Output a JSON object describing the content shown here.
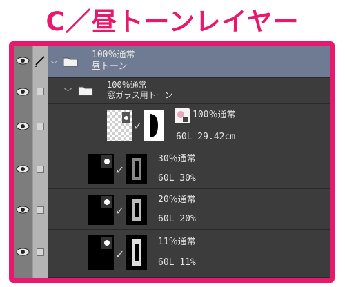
{
  "title": "C／昼トーンレイヤー",
  "colors": {
    "accent": "#e8196c",
    "selected_row": "#6e7b93",
    "panel_bg": "#3c3c3c"
  },
  "layers": [
    {
      "kind": "folder",
      "blend": "100％通常",
      "name": "昼トーン",
      "selected": true
    },
    {
      "kind": "folder",
      "blend": "100％通常",
      "name": "窓ガラス用トーン"
    },
    {
      "kind": "tone",
      "blend": "100％通常",
      "detail": "60L 29.42cm"
    },
    {
      "kind": "tone",
      "blend": "30％通常",
      "detail": "60L 30%"
    },
    {
      "kind": "tone",
      "blend": "20％通常",
      "detail": "60L 20%"
    },
    {
      "kind": "tone",
      "blend": "11％通常",
      "detail": "60L 11%"
    }
  ]
}
